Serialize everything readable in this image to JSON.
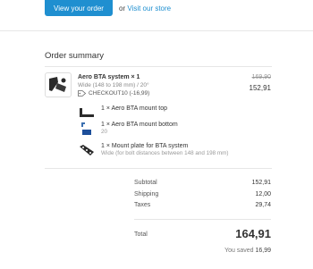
{
  "top": {
    "view_order_label": "View your order",
    "or_text": "or",
    "visit_store_label": "Visit our store"
  },
  "summary": {
    "title": "Order summary",
    "product": {
      "name": "Aero BTA system × 1",
      "variant": "Wide (148 to 198 mm) / 20°",
      "discount_code": "CHECKOUT10 (-16,99)",
      "price_original": "169,90",
      "price_final": "152,91"
    },
    "bundle_items": [
      {
        "name": "1 × Aero BTA mount top",
        "variant": ""
      },
      {
        "name": "1 × Aero BTA mount bottom",
        "variant": "20"
      },
      {
        "name": "1 × Mount plate for BTA system",
        "variant": "Wide (for bolt distances between 148 and 198 mm)"
      }
    ],
    "totals": {
      "subtotal_label": "Subtotal",
      "subtotal_value": "152,91",
      "shipping_label": "Shipping",
      "shipping_value": "12,00",
      "taxes_label": "Taxes",
      "taxes_value": "29,74",
      "total_label": "Total",
      "total_value": "164,91",
      "saved_label": "You saved",
      "saved_value": "16,99"
    }
  },
  "colors": {
    "accent": "#1f8fd0",
    "text": "#333333",
    "muted": "#999999"
  }
}
